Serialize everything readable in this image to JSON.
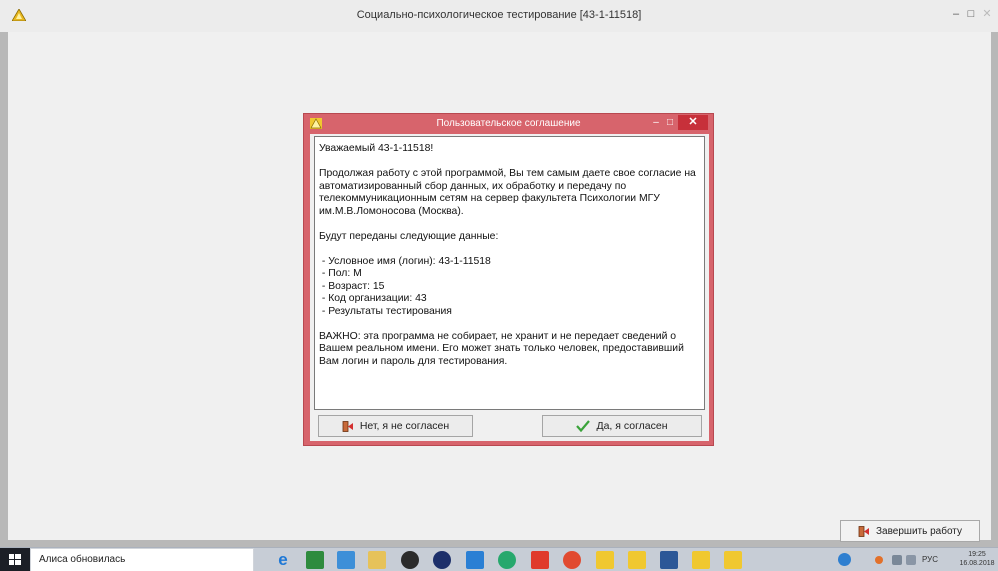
{
  "main_window": {
    "title": "Социально-психологическое тестирование [43-1-11518]",
    "controls": {
      "minimize": "–",
      "maximize": "□",
      "close": "✕"
    },
    "finish_button": "Завершить работу"
  },
  "dialog": {
    "title": "Пользовательское соглашение",
    "controls": {
      "minimize": "–",
      "maximize": "□",
      "close": "✕"
    },
    "text": "Уважаемый 43-1-11518!\n\nПродолжая работу с этой программой, Вы тем самым даете свое согласие на автоматизированный сбор данных, их обработку и передачу по телекоммуникационным сетям на сервер факультета Психологии МГУ им.М.В.Ломоносова (Москва).\n\nБудут переданы следующие данные:\n\n - Условное имя (логин): 43-1-11518\n - Пол: М\n - Возраст: 15\n - Код организации: 43\n - Результаты тестирования\n\nВАЖНО: эта программа не собирает, не хранит и не передает сведений о Вашем реальном имени. Его может знать только человек, предоставивший Вам логин и пароль для тестирования.",
    "decline_button": "Нет, я не согласен",
    "accept_button": "Да, я согласен"
  },
  "taskbar": {
    "notification": "Алиса обновилась",
    "apps": [
      "internet-explorer",
      "file-manager",
      "paint",
      "file-explorer",
      "media",
      "hp",
      "store",
      "app",
      "yandex",
      "chrome",
      "test-app",
      "test-app",
      "word",
      "test-app",
      "test-app"
    ],
    "language": "РУС",
    "time": "19:25",
    "date": "16.08.2018"
  },
  "colors": {
    "dialog_frame": "#d7646c",
    "close_button": "#c7303a",
    "accept_check": "#3aa33a",
    "taskbar": "#c7cdd6"
  }
}
